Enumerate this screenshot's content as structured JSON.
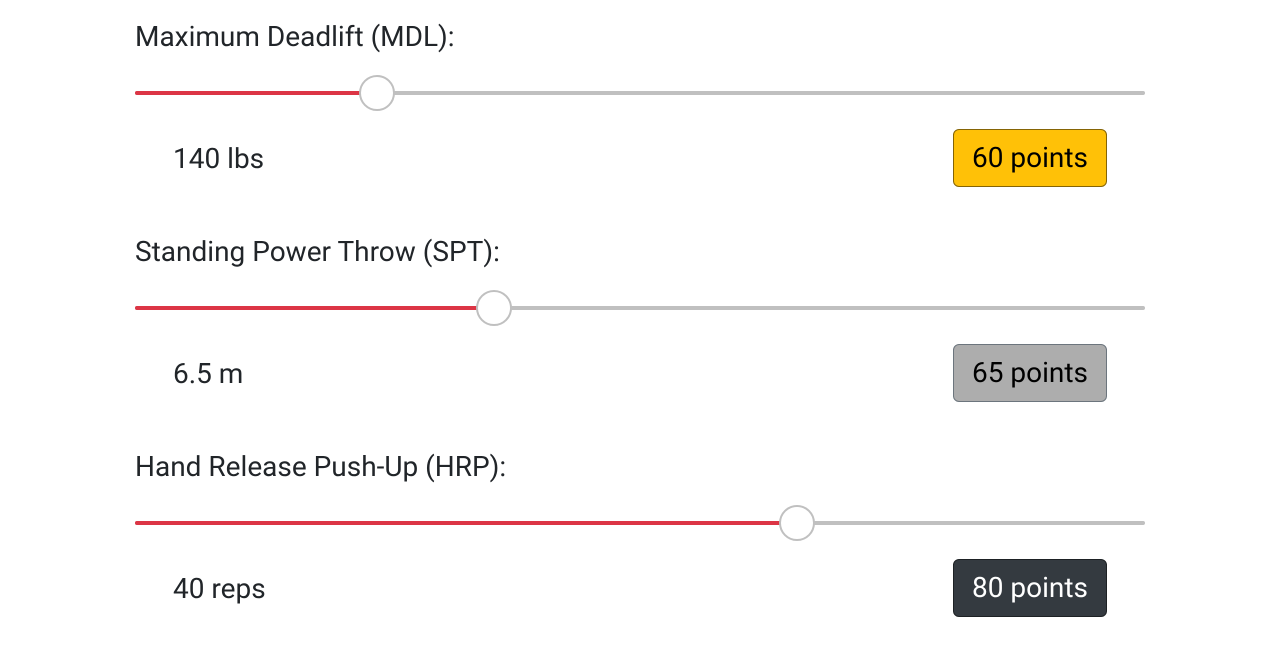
{
  "exercises": [
    {
      "label": "Maximum Deadlift (MDL):",
      "value": "140 lbs",
      "points": "60 points",
      "fill_percent": 24,
      "badge_class": "badge-warning"
    },
    {
      "label": "Standing Power Throw (SPT):",
      "value": "6.5 m",
      "points": "65 points",
      "fill_percent": 35.5,
      "badge_class": "badge-secondary"
    },
    {
      "label": "Hand Release Push-Up (HRP):",
      "value": "40 reps",
      "points": "80 points",
      "fill_percent": 65.5,
      "badge_class": "badge-dark"
    }
  ]
}
